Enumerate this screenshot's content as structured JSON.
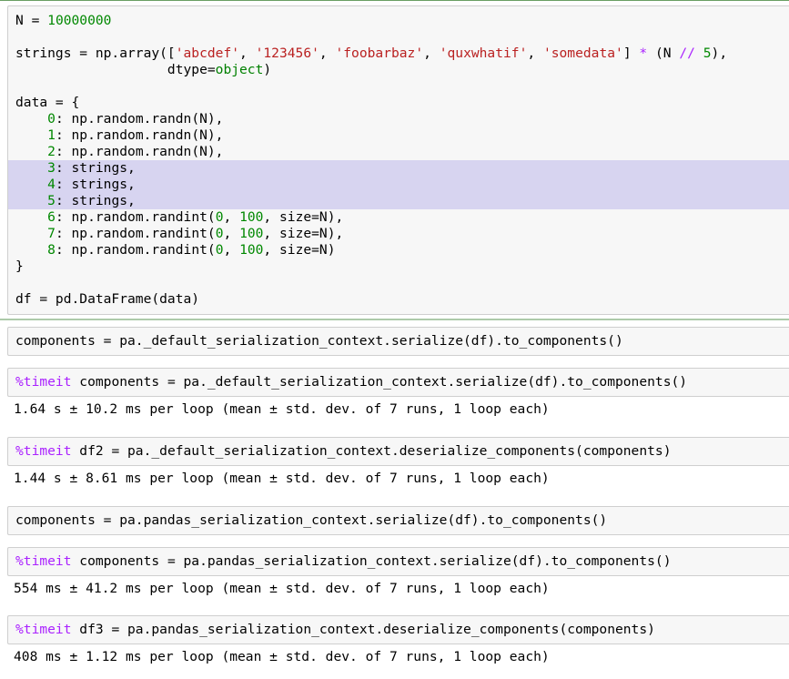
{
  "cell1": {
    "lines": [
      [
        {
          "t": "N = ",
          "c": ""
        },
        {
          "t": "10000000",
          "c": "num"
        }
      ],
      [],
      [
        {
          "t": "strings = np.array([",
          "c": ""
        },
        {
          "t": "'abcdef'",
          "c": "str"
        },
        {
          "t": ", ",
          "c": ""
        },
        {
          "t": "'123456'",
          "c": "str"
        },
        {
          "t": ", ",
          "c": ""
        },
        {
          "t": "'foobarbaz'",
          "c": "str"
        },
        {
          "t": ", ",
          "c": ""
        },
        {
          "t": "'quxwhatif'",
          "c": "str"
        },
        {
          "t": ", ",
          "c": ""
        },
        {
          "t": "'somedata'",
          "c": "str"
        },
        {
          "t": "] ",
          "c": ""
        },
        {
          "t": "*",
          "c": "op"
        },
        {
          "t": " (N ",
          "c": ""
        },
        {
          "t": "//",
          "c": "op"
        },
        {
          "t": " ",
          "c": ""
        },
        {
          "t": "5",
          "c": "num"
        },
        {
          "t": "),",
          "c": ""
        }
      ],
      [
        {
          "t": "                   dtype=",
          "c": ""
        },
        {
          "t": "object",
          "c": "bi"
        },
        {
          "t": ")",
          "c": ""
        }
      ],
      [],
      [
        {
          "t": "data = {",
          "c": ""
        }
      ],
      [
        {
          "t": "    ",
          "c": ""
        },
        {
          "t": "0",
          "c": "num"
        },
        {
          "t": ": np.random.randn(N),",
          "c": ""
        }
      ],
      [
        {
          "t": "    ",
          "c": ""
        },
        {
          "t": "1",
          "c": "num"
        },
        {
          "t": ": np.random.randn(N),",
          "c": ""
        }
      ],
      [
        {
          "t": "    ",
          "c": ""
        },
        {
          "t": "2",
          "c": "num"
        },
        {
          "t": ": np.random.randn(N),",
          "c": ""
        }
      ],
      [
        {
          "t": "    ",
          "c": ""
        },
        {
          "t": "3",
          "c": "num"
        },
        {
          "t": ": strings,",
          "c": ""
        }
      ],
      [
        {
          "t": "    ",
          "c": ""
        },
        {
          "t": "4",
          "c": "num"
        },
        {
          "t": ": strings,",
          "c": ""
        }
      ],
      [
        {
          "t": "    ",
          "c": ""
        },
        {
          "t": "5",
          "c": "num"
        },
        {
          "t": ": strings,",
          "c": ""
        }
      ],
      [
        {
          "t": "    ",
          "c": ""
        },
        {
          "t": "6",
          "c": "num"
        },
        {
          "t": ": np.random.randint(",
          "c": ""
        },
        {
          "t": "0",
          "c": "num"
        },
        {
          "t": ", ",
          "c": ""
        },
        {
          "t": "100",
          "c": "num"
        },
        {
          "t": ", size=N),",
          "c": ""
        }
      ],
      [
        {
          "t": "    ",
          "c": ""
        },
        {
          "t": "7",
          "c": "num"
        },
        {
          "t": ": np.random.randint(",
          "c": ""
        },
        {
          "t": "0",
          "c": "num"
        },
        {
          "t": ", ",
          "c": ""
        },
        {
          "t": "100",
          "c": "num"
        },
        {
          "t": ", size=N),",
          "c": ""
        }
      ],
      [
        {
          "t": "    ",
          "c": ""
        },
        {
          "t": "8",
          "c": "num"
        },
        {
          "t": ": np.random.randint(",
          "c": ""
        },
        {
          "t": "0",
          "c": "num"
        },
        {
          "t": ", ",
          "c": ""
        },
        {
          "t": "100",
          "c": "num"
        },
        {
          "t": ", size=N)",
          "c": ""
        }
      ],
      [
        {
          "t": "}",
          "c": ""
        }
      ],
      [],
      [
        {
          "t": "df = pd.DataFrame(data)",
          "c": ""
        }
      ]
    ],
    "highlighted_lines": [
      9,
      10,
      11
    ]
  },
  "cell2": {
    "code": "components = pa._default_serialization_context.serialize(df).to_components()"
  },
  "cell3": {
    "magic": "%timeit",
    "code": " components = pa._default_serialization_context.serialize(df).to_components()",
    "output": "1.64 s ± 10.2 ms per loop (mean ± std. dev. of 7 runs, 1 loop each)"
  },
  "cell4": {
    "magic": "%timeit",
    "code": " df2 = pa._default_serialization_context.deserialize_components(components)",
    "output": "1.44 s ± 8.61 ms per loop (mean ± std. dev. of 7 runs, 1 loop each)"
  },
  "cell5": {
    "code": "components = pa.pandas_serialization_context.serialize(df).to_components()"
  },
  "cell6": {
    "magic": "%timeit",
    "code": " components = pa.pandas_serialization_context.serialize(df).to_components()",
    "output": "554 ms ± 41.2 ms per loop (mean ± std. dev. of 7 runs, 1 loop each)"
  },
  "cell7": {
    "magic": "%timeit",
    "code": " df3 = pa.pandas_serialization_context.deserialize_components(components)",
    "output": "408 ms ± 1.12 ms per loop (mean ± std. dev. of 7 runs, 1 loop each)"
  }
}
